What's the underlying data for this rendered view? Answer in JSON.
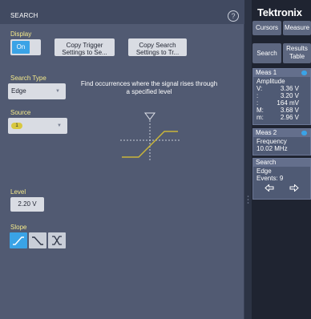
{
  "search_panel": {
    "title": "SEARCH",
    "help": "?",
    "display_label": "Display",
    "display_toggle": "On",
    "copy_trigger_button": "Copy Trigger\nSettings to Se...",
    "copy_search_button": "Copy Search\nSettings to Tr...",
    "search_type_label": "Search Type",
    "search_type_value": "Edge",
    "description": "Find occurrences where the signal rises through a specified level",
    "source_label": "Source",
    "source_value": "1",
    "level_label": "Level",
    "level_value": "2.20 V",
    "slope_label": "Slope",
    "slope_options": [
      "rising-edge-icon",
      "falling-edge-icon",
      "either-edge-icon"
    ],
    "slope_selected": "rising"
  },
  "sidebar": {
    "brand": "Tektronix",
    "cursors_button": "Cursors",
    "measure_button": "Measure",
    "search_button": "Search",
    "results_button": "Results\nTable",
    "meas1": {
      "title": "Meas 1",
      "name": "Amplitude",
      "rows": [
        {
          "k": "V:",
          "v": "3.36 V"
        },
        {
          "k": ":",
          "v": "3.20 V"
        },
        {
          "k": ":",
          "v": "164 mV"
        },
        {
          "k": "M:",
          "v": "3.68 V"
        },
        {
          "k": "m:",
          "v": "2.96 V"
        }
      ]
    },
    "meas2": {
      "title": "Meas 2",
      "name": "Frequency",
      "value": "10.02 MHz"
    },
    "search": {
      "title": "Search",
      "type": "Edge",
      "events": "Events: 9"
    }
  },
  "colors": {
    "accent": "#3aa3e6",
    "label": "#f4e98a",
    "panel": "#515a72",
    "signal": "#c9b53a"
  }
}
